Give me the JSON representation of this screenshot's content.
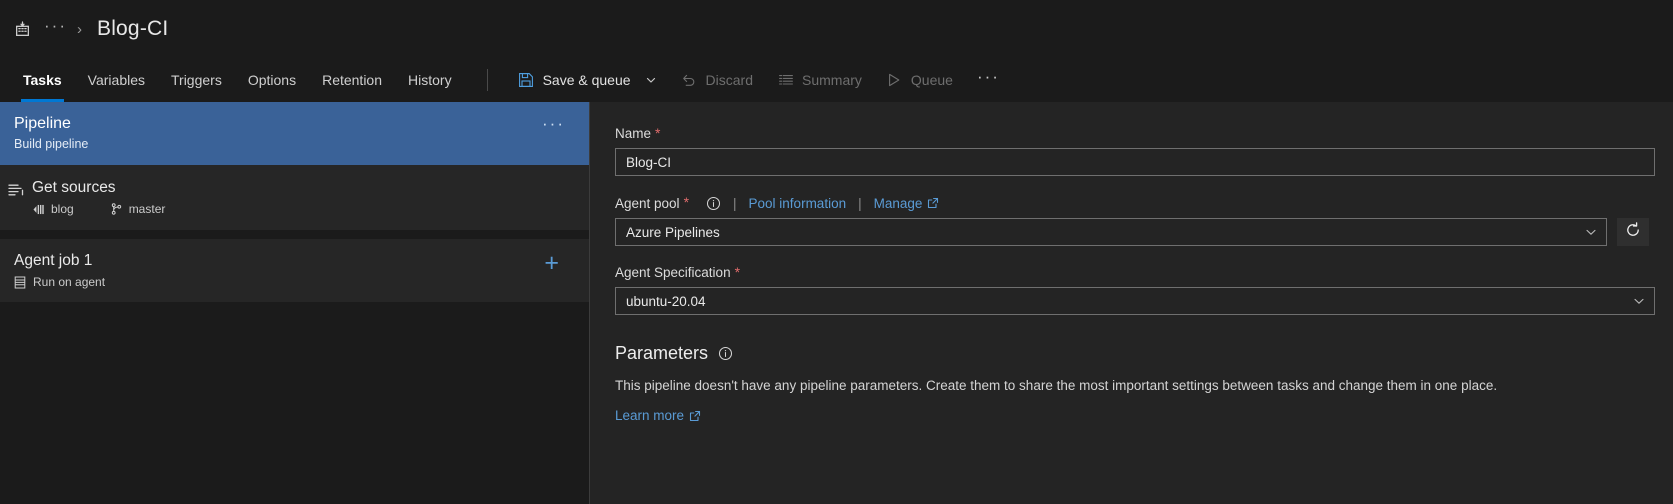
{
  "breadcrumb": {
    "home_icon": "pipelines-home-icon",
    "ellipsis": "···",
    "separator": "›",
    "title": "Blog-CI"
  },
  "toolbar": {
    "tabs": [
      {
        "label": "Tasks",
        "active": true
      },
      {
        "label": "Variables",
        "active": false
      },
      {
        "label": "Triggers",
        "active": false
      },
      {
        "label": "Options",
        "active": false
      },
      {
        "label": "Retention",
        "active": false
      },
      {
        "label": "History",
        "active": false
      }
    ],
    "actions": [
      {
        "label": "Save & queue",
        "icon": "save-icon",
        "disabled": false,
        "has_chevron": true
      },
      {
        "label": "Discard",
        "icon": "undo-icon",
        "disabled": true,
        "has_chevron": false
      },
      {
        "label": "Summary",
        "icon": "list-icon",
        "disabled": true,
        "has_chevron": false
      },
      {
        "label": "Queue",
        "icon": "play-icon",
        "disabled": true,
        "has_chevron": false
      }
    ],
    "more_label": "···"
  },
  "left_pane": {
    "pipeline": {
      "title": "Pipeline",
      "subtitle": "Build pipeline",
      "more_label": "···",
      "selected_color": "#3a6298"
    },
    "get_sources": {
      "title": "Get sources",
      "repo": "blog",
      "branch": "master",
      "repo_icon": "azure-repos-icon",
      "branch_icon": "branch-icon",
      "row_icon": "get-sources-icon"
    },
    "agent_job": {
      "title": "Agent job 1",
      "subtitle": "Run on agent",
      "subtitle_icon": "server-icon",
      "add_label": "+"
    }
  },
  "right_pane": {
    "name": {
      "label": "Name",
      "required": "*",
      "value": "Blog-CI"
    },
    "agent_pool": {
      "label": "Agent pool",
      "required": "*",
      "info_icon": "info-icon",
      "separator": "|",
      "pool_information_link": "Pool information",
      "manage_link": "Manage",
      "external_icon": "external-link-icon",
      "value": "Azure Pipelines",
      "chevron_icon": "chevron-down-icon",
      "refresh_icon": "refresh-icon"
    },
    "agent_specification": {
      "label": "Agent Specification",
      "required": "*",
      "value": "ubuntu-20.04",
      "chevron_icon": "chevron-down-icon"
    },
    "parameters": {
      "title": "Parameters",
      "info_icon": "info-icon",
      "description": "This pipeline doesn't have any pipeline parameters. Create them to share the most important settings between tasks and change them in one place.",
      "learn_more": "Learn more",
      "external_icon": "external-link-icon"
    }
  },
  "colors": {
    "accent": "#0078d4",
    "link": "#5a9bd5",
    "selected_row": "#3a6298",
    "required_star": "#e06c6c",
    "page_bg": "#1b1b1b",
    "panel_bg": "#242424"
  }
}
